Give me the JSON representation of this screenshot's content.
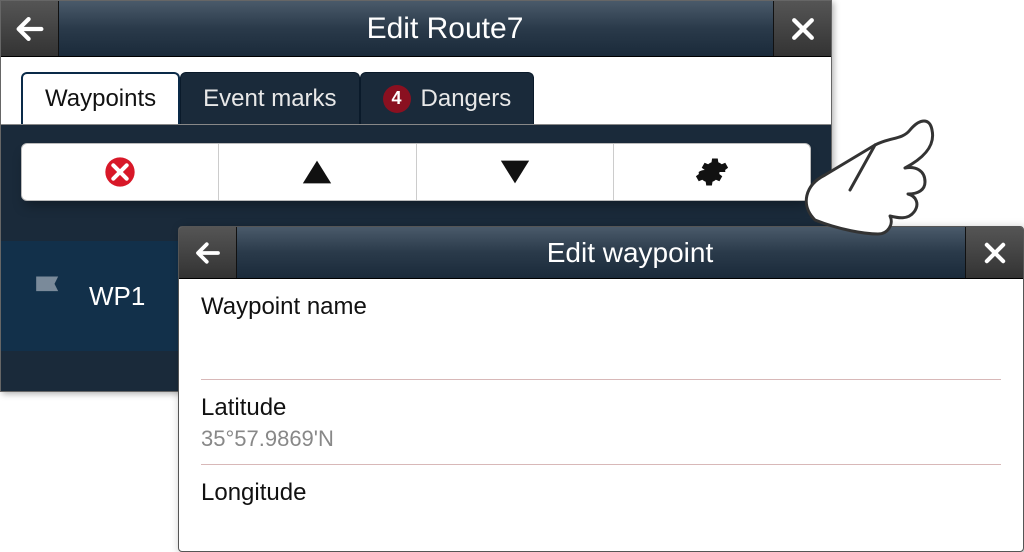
{
  "parent": {
    "title": "Edit Route7",
    "tabs": {
      "waypoints": "Waypoints",
      "event_marks": "Event marks",
      "dangers": {
        "label": "Dangers",
        "count": "4"
      }
    },
    "waypoint_row": {
      "label": "WP1"
    }
  },
  "child": {
    "title": "Edit waypoint",
    "fields": {
      "name": {
        "label": "Waypoint name",
        "value": ""
      },
      "latitude": {
        "label": "Latitude",
        "value": "35°57.9869'N"
      },
      "longitude": {
        "label": "Longitude"
      }
    }
  }
}
